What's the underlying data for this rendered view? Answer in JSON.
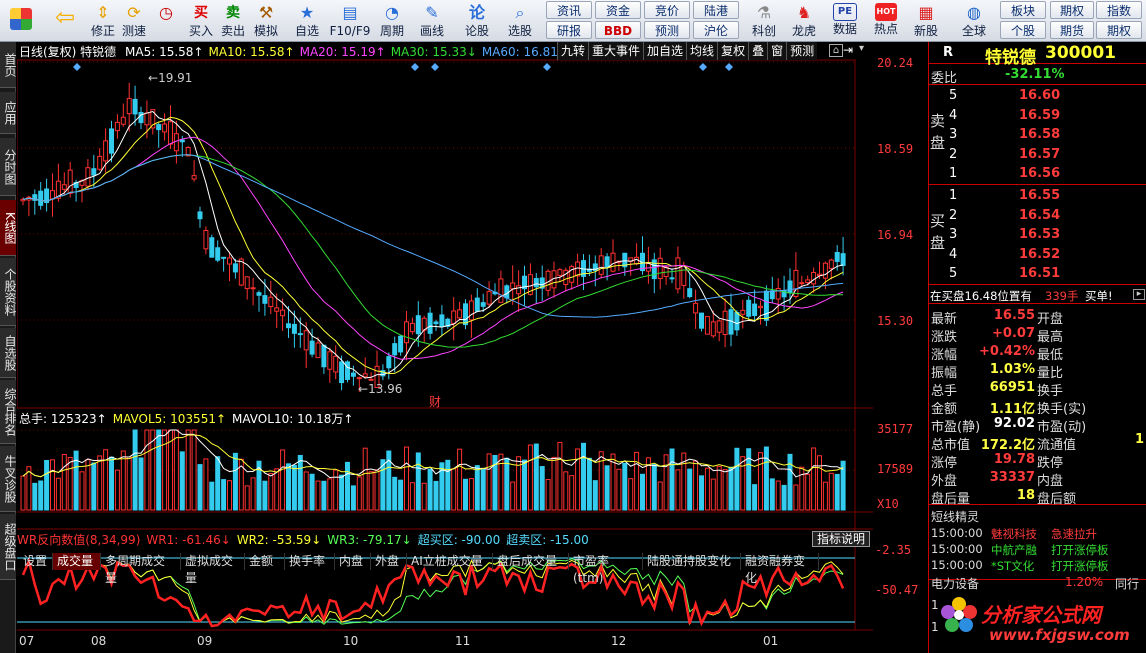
{
  "toolbar": {
    "buttons": [
      {
        "label": "",
        "icon": "windows-grid-icon"
      },
      {
        "label": "",
        "icon": "back-arrow-icon"
      },
      {
        "label": "修正",
        "icon": "arrow-updown-icon"
      },
      {
        "label": "测速",
        "icon": "refresh-icon"
      },
      {
        "label": "买入",
        "icon": "buy-icon",
        "glyph": "买"
      },
      {
        "label": "卖出",
        "icon": "sell-icon",
        "glyph": "卖"
      },
      {
        "label": "模拟",
        "icon": "hammer-icon"
      },
      {
        "label": "自选",
        "icon": "star-icon"
      },
      {
        "label": "F10/F9",
        "icon": "document-icon"
      },
      {
        "label": "周期",
        "icon": "cycle-icon"
      },
      {
        "label": "画线",
        "icon": "pencil-icon"
      },
      {
        "label": "论股",
        "icon": "forum-icon"
      },
      {
        "label": "选股",
        "icon": "magnify-chart-icon"
      }
    ],
    "small_buttons": [
      "资讯",
      "资金",
      "竞价",
      "陆港",
      "研报",
      "BBD",
      "预测",
      "沪伦"
    ],
    "right_buttons": [
      {
        "label": "科创",
        "icon": "tech-icon"
      },
      {
        "label": "龙虎",
        "icon": "dragon-icon"
      },
      {
        "label": "数据",
        "icon": "pe-icon",
        "glyph": "PE"
      },
      {
        "label": "热点",
        "icon": "hot-icon",
        "glyph": "HOT"
      },
      {
        "label": "新股",
        "icon": "newstock-icon"
      },
      {
        "label": "全球",
        "icon": "globe-icon"
      }
    ],
    "right_small": [
      "板块",
      "期权",
      "个股",
      "期货",
      "指数",
      "期权"
    ]
  },
  "left_tabs": [
    "首页",
    "应用",
    "分时图",
    "K线图",
    "个股资料",
    "自选股",
    "综合排名",
    "牛叉诊股",
    "超级盘口"
  ],
  "chart": {
    "header": "日线(复权) 特锐德",
    "ma": [
      {
        "label": "MA5: 15.58↑",
        "color": "#ffffff"
      },
      {
        "label": "MA10: 15.58↑",
        "color": "#ffff33"
      },
      {
        "label": "MA20: 15.19↑",
        "color": "#ff44ff"
      },
      {
        "label": "MA30: 15.33↓",
        "color": "#33dd33"
      },
      {
        "label": "MA60: 16.81↓",
        "color": "#55aaff"
      }
    ],
    "header_buttons": [
      "九转",
      "重大事件",
      "加自选",
      "均线",
      "复权",
      "叠",
      "窗",
      "预测"
    ],
    "price_ticks": [
      "20.24",
      "18.59",
      "16.94",
      "15.30"
    ],
    "high_label": "19.91",
    "low_label": "13.96",
    "event_label": "财",
    "volume_header": [
      {
        "label": "总手: 125323↑",
        "color": "#ffffff"
      },
      {
        "label": "MAVOL5: 103551↑",
        "color": "#ffff33"
      },
      {
        "label": "MAVOL10: 10.18万↑",
        "color": "#ffffff"
      }
    ],
    "volume_ticks": [
      "35177",
      "17589"
    ],
    "volume_unit": "X10",
    "tabs": [
      "设置",
      "成交量",
      "多周期成交量",
      "虚拟成交量",
      "金额",
      "换手率",
      "内盘",
      "外盘",
      "AI立桩成交量",
      "盘后成交量",
      "市盈率(ttm)",
      "陆股通持股变化",
      "融资融券变化"
    ],
    "active_tab": "成交量",
    "wr_header": [
      {
        "label": "WR反向数值(8,34,99)",
        "color": "#ff3333"
      },
      {
        "label": "WR1: -61.46↓",
        "color": "#ff3333"
      },
      {
        "label": "WR2: -53.59↓",
        "color": "#ffff33"
      },
      {
        "label": "WR3: -79.17↓",
        "color": "#55ff55"
      },
      {
        "label": "超买区: -90.00",
        "color": "#55ddff"
      },
      {
        "label": "超卖区: -15.00",
        "color": "#55ddff"
      }
    ],
    "wr_button": "指标说明",
    "wr_ticks": [
      "-2.35",
      "-50.47"
    ],
    "months": [
      "07",
      "08",
      "09",
      "10",
      "11",
      "12",
      "01"
    ]
  },
  "quote": {
    "code_label": "R",
    "name": "特锐德",
    "code": "300001",
    "weibi_label": "委比",
    "weibi_value": "-32.11%",
    "sell_label": "卖盘",
    "buy_label": "买盘",
    "sell": [
      {
        "n": "5",
        "p": "16.60"
      },
      {
        "n": "4",
        "p": "16.59"
      },
      {
        "n": "3",
        "p": "16.58"
      },
      {
        "n": "2",
        "p": "16.57"
      },
      {
        "n": "1",
        "p": "16.56"
      }
    ],
    "buy": [
      {
        "n": "1",
        "p": "16.55"
      },
      {
        "n": "2",
        "p": "16.54"
      },
      {
        "n": "3",
        "p": "16.53"
      },
      {
        "n": "4",
        "p": "16.52"
      },
      {
        "n": "5",
        "p": "16.51"
      }
    ],
    "note_pre": "在买盘16.48位置有",
    "note_qty": "339手",
    "note_action": "买单!",
    "info": [
      {
        "l": "最新",
        "v": "16.55",
        "vc": "#ff3b3b",
        "r": "开盘"
      },
      {
        "l": "涨跌",
        "v": "+0.07",
        "vc": "#ff3b3b",
        "r": "最高"
      },
      {
        "l": "涨幅",
        "v": "+0.42%",
        "vc": "#ff3b3b",
        "r": "最低"
      },
      {
        "l": "振幅",
        "v": "1.03%",
        "vc": "#ffff44",
        "r": "量比"
      },
      {
        "l": "总手",
        "v": "66951",
        "vc": "#ffff44",
        "r": "换手"
      },
      {
        "l": "金额",
        "v": "1.11亿",
        "vc": "#ffff44",
        "r": "换手(实)"
      },
      {
        "l": "市盈(静)",
        "v": "92.02",
        "vc": "#ffffff",
        "r": "市盈(动)"
      },
      {
        "l": "总市值",
        "v": "172.2亿",
        "vc": "#ffff44",
        "r": "流通值"
      },
      {
        "l": "涨停",
        "v": "19.78",
        "vc": "#ff3b3b",
        "r": "跌停"
      },
      {
        "l": "外盘",
        "v": "33337",
        "vc": "#ff3b3b",
        "r": "内盘"
      },
      {
        "l": "盘后量",
        "v": "18",
        "vc": "#ffff44",
        "r": "盘后额"
      }
    ],
    "extra_right": "1",
    "news_title": "短线精灵",
    "news": [
      {
        "t": "15:00:00",
        "s": "魅视科技",
        "e": "急速拉升",
        "c": "#ff3b3b"
      },
      {
        "t": "15:00:00",
        "s": "中航产融",
        "e": "打开涨停板",
        "c": "#33dd33"
      },
      {
        "t": "15:00:00",
        "s": "*ST文化",
        "e": "打开涨停板",
        "c": "#33dd33"
      }
    ],
    "sector_name": "电力设备",
    "sector_pct": "1.20%",
    "sector_more": "同行",
    "footer_1": "1",
    "footer_2": "1",
    "watermark_title": "分析家公式网",
    "watermark_url": "www.fxjgsw.com"
  },
  "colors": {
    "up": "#ff3030",
    "down": "#33ccee",
    "ma5": "#ffffff",
    "ma10": "#ffff33",
    "ma20": "#ff44ff",
    "ma30": "#33dd33",
    "ma60": "#55aaff",
    "grid": "#7a0000"
  }
}
